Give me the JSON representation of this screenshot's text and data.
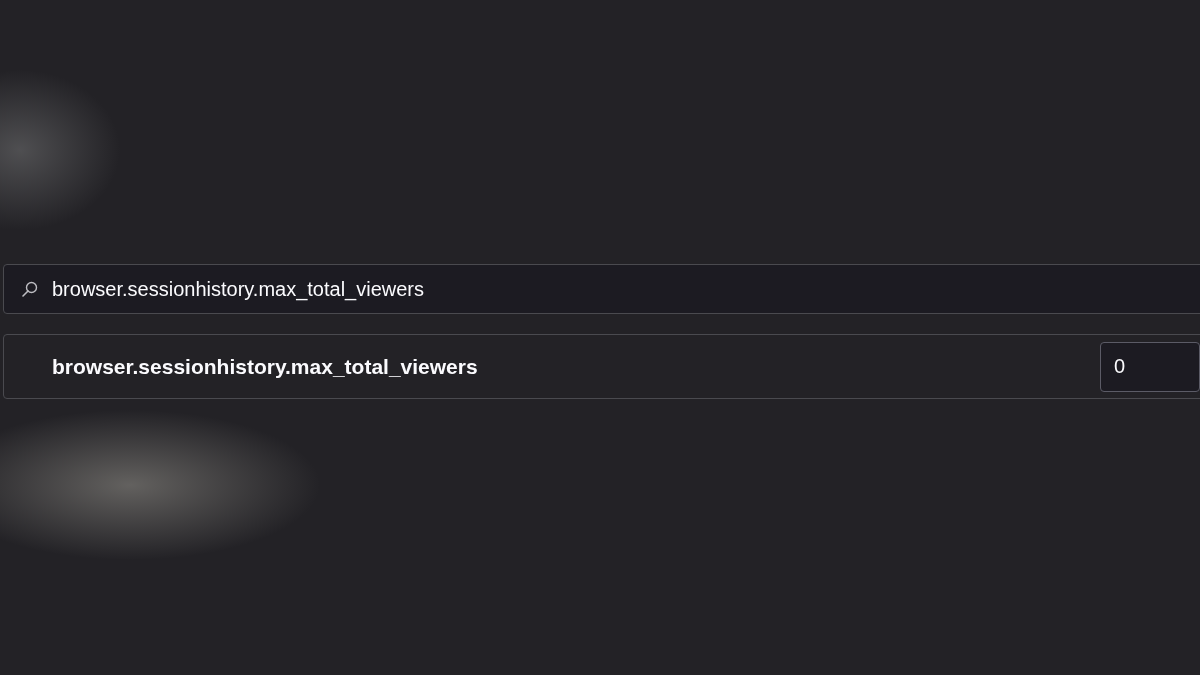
{
  "search": {
    "value": "browser.sessionhistory.max_total_viewers"
  },
  "preferences": [
    {
      "name": "browser.sessionhistory.max_total_viewers",
      "modified": true,
      "value": "0"
    }
  ]
}
